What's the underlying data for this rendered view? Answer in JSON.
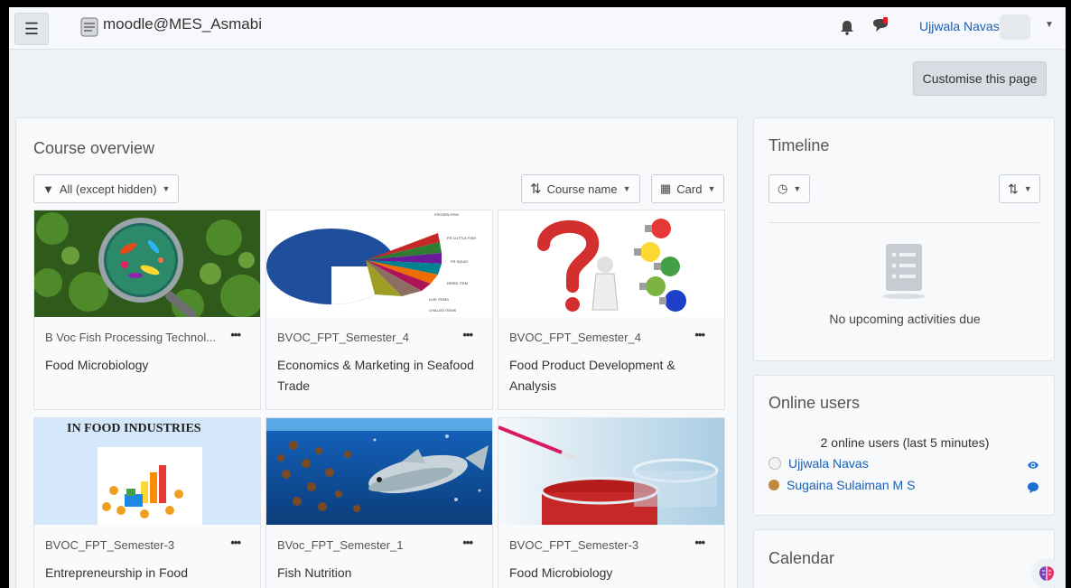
{
  "navbar": {
    "site_name": "moodle@MES_Asmabi",
    "user_name": "Ujjwala Navas"
  },
  "customise_label": "Customise this page",
  "course_overview": {
    "title": "Course overview",
    "filter_label": "All (except hidden)",
    "sort_label": "Course name",
    "view_label": "Card",
    "more_label": "•••",
    "courses": [
      {
        "category": "B Voc Fish Processing Technol...",
        "name": "Food Microbiology"
      },
      {
        "category": "BVOC_FPT_Semester_4",
        "name": "Economics & Marketing in Seafood Trade"
      },
      {
        "category": "BVOC_FPT_Semester_4",
        "name": "Food Product Development & Analysis"
      },
      {
        "category": "BVOC_FPT_Semester-3",
        "name": "Entrepreneurship in Food"
      },
      {
        "category": "BVoc_FPT_Semester_1",
        "name": "Fish Nutrition"
      },
      {
        "category": "BVOC_FPT_Semester-3",
        "name": "Food Microbiology"
      }
    ],
    "image_texts": {
      "entrepreneurship_banner": "IN FOOD INDUSTRIES"
    }
  },
  "timeline": {
    "title": "Timeline",
    "empty_text": "No upcoming activities due"
  },
  "online_users": {
    "title": "Online users",
    "count_text": "2 online users (last 5 minutes)",
    "users": [
      "Ujjwala Navas",
      "Sugaina Sulaiman M S"
    ]
  },
  "calendar": {
    "title": "Calendar"
  },
  "colors": {
    "link": "#1a5fb4",
    "background": "#eef2f6",
    "panel": "#f7f9fb"
  }
}
